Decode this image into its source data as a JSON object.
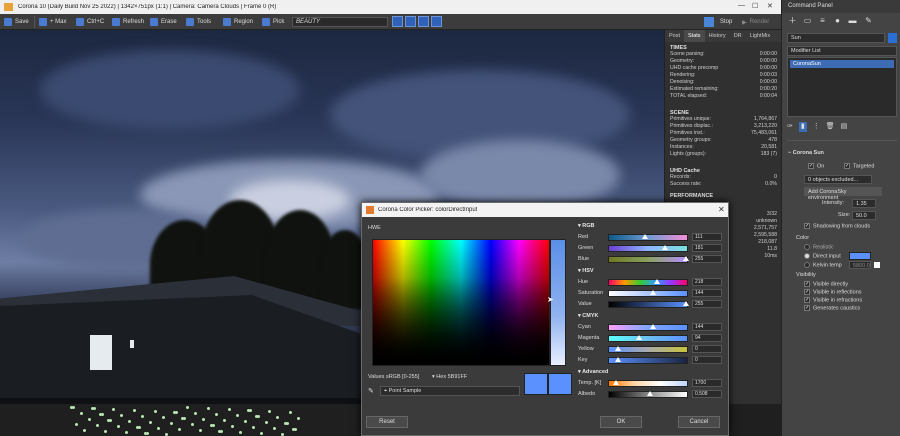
{
  "vfb": {
    "title": "Corona 10 (Daily Build Nov 25 2022) | 1342×751px (1:1) | Camera: Camera Clouds | Frame 0 (R)",
    "toolbar": {
      "save": "Save",
      "max": "+ Max",
      "copy": "Ctrl+C",
      "refresh": "Refresh",
      "erase": "Erase",
      "tools": "Tools",
      "region": "Region",
      "pick": "Pick",
      "beauty": "BEAUTY",
      "stop": "Stop",
      "render": "Render"
    },
    "tabs": [
      "Post",
      "Stats",
      "History",
      "DR",
      "LightMix"
    ],
    "times": {
      "header": "TIMES",
      "rows": [
        [
          "Scene parsing:",
          "0:00:00"
        ],
        [
          "Geometry:",
          "0:00:00"
        ],
        [
          "UHD cache precomp",
          "0:00:00"
        ],
        [
          "Rendering:",
          "0:00:03"
        ],
        [
          "Denoising:",
          "0:00:00"
        ],
        [
          "Estimated remaining:",
          "0:00:20"
        ],
        [
          "TOTAL elapsed:",
          "0:00:04"
        ]
      ]
    },
    "scene": {
      "header": "SCENE",
      "rows": [
        [
          "Primitives unique:",
          "1,764,867"
        ],
        [
          "Primitives displac.:",
          "3,213,220"
        ],
        [
          "Primitives inst.:",
          "75,483,061"
        ],
        [
          "Geometry groups:",
          "478"
        ],
        [
          "Instances:",
          "20,581"
        ],
        [
          "Lights (groups):",
          "183 (7)"
        ]
      ]
    },
    "uhd": {
      "header": "UHD Cache",
      "rows": [
        [
          "Records:",
          "0"
        ],
        [
          "Success rate:",
          "0.0%"
        ]
      ]
    },
    "perf": {
      "header": "PERFORMANCE",
      "values": [
        "3/32",
        "unknown",
        "2,571,757",
        "2,595,588",
        "218,087",
        "11.8",
        "10ms"
      ]
    }
  },
  "cmd": {
    "title": "Command Panel",
    "object_name": "Sun",
    "modifier_list": "Modifier List",
    "stack_item": "CoronaSun",
    "rollout": "Corona Sun",
    "on": "On",
    "targeted": "Targeted",
    "excluded": "0 objects excluded...",
    "add_env": "Add CoronaSky environment",
    "intensity_label": "Intensity:",
    "intensity": "1.35",
    "size_label": "Size:",
    "size": "50.0",
    "shadowing": "Shadowing from clouds",
    "color": "Color",
    "realistic": "Realistic",
    "direct": "Direct input",
    "kelvin": "Kelvin temp",
    "kelvin_val": "5800.0",
    "visibility": "Visibility",
    "vis_items": [
      "Visible directly",
      "Visible in reflections",
      "Visible in refractions",
      "Generates caustics"
    ],
    "sun_color": "#5b91ff"
  },
  "dialog": {
    "title": "Corona Color Picker: colorDirectInput",
    "hwe": "HWE",
    "values_label": "Values",
    "values_mode": "sRGB [0-255]",
    "hex_label": "Hex",
    "hex": "5B91FF",
    "point_sample": "Point Sample",
    "reset": "Reset",
    "ok": "OK",
    "cancel": "Cancel",
    "groups": {
      "rgb": {
        "title": "RGB",
        "rows": [
          {
            "label": "Red",
            "value": "111"
          },
          {
            "label": "Green",
            "value": "181"
          },
          {
            "label": "Blue",
            "value": "255"
          }
        ]
      },
      "hsv": {
        "title": "HSV",
        "rows": [
          {
            "label": "Hue",
            "value": "218"
          },
          {
            "label": "Saturation",
            "value": "144"
          },
          {
            "label": "Value",
            "value": "255"
          }
        ]
      },
      "cmyk": {
        "title": "CMYK",
        "rows": [
          {
            "label": "Cyan",
            "value": "144"
          },
          {
            "label": "Magenta",
            "value": "94"
          },
          {
            "label": "Yellow",
            "value": "0"
          },
          {
            "label": "Key",
            "value": "0"
          }
        ]
      },
      "adv": {
        "title": "Advanced",
        "rows": [
          {
            "label": "Temp. [K]",
            "value": "1700"
          },
          {
            "label": "Albedo",
            "value": "0.508"
          }
        ]
      }
    },
    "selected_color": "#5b91ff"
  }
}
